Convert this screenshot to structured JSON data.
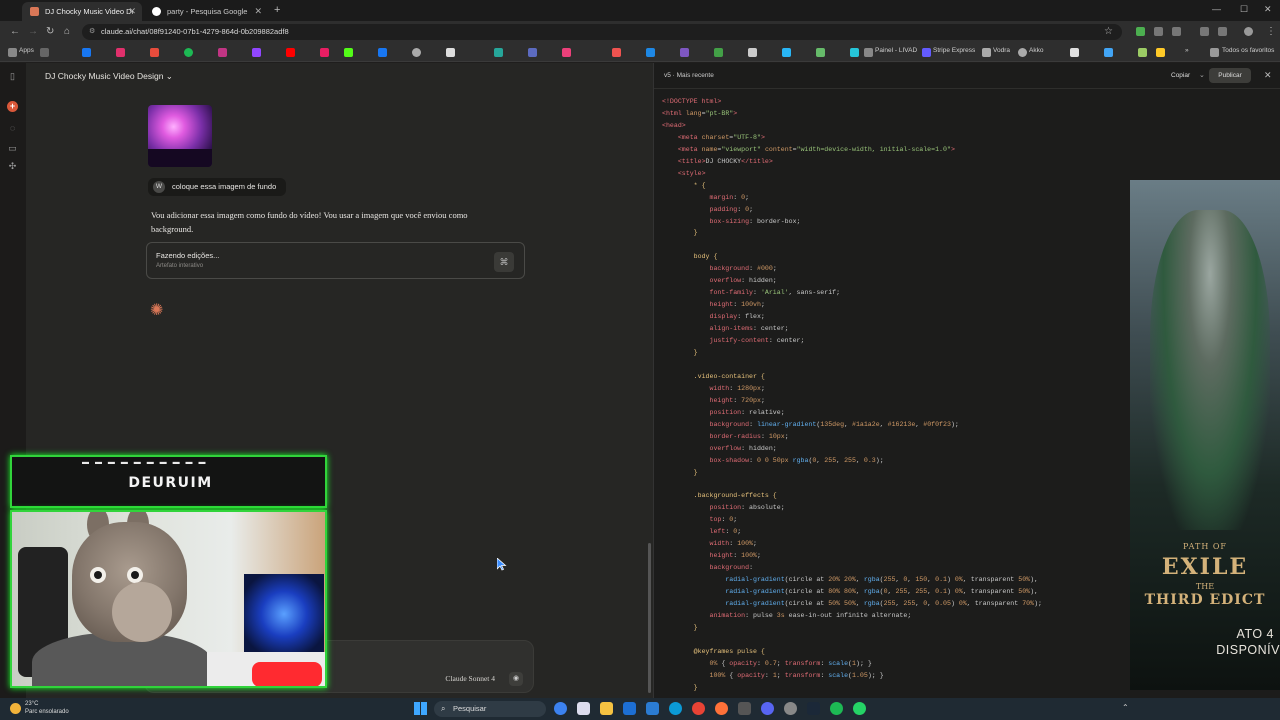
{
  "browser": {
    "tabs": [
      {
        "title": "DJ Chocky Music Video Design"
      },
      {
        "title": "party - Pesquisa Google"
      }
    ],
    "url": "claude.ai/chat/08f91240-07b1-4279-864d-0b209882adf8",
    "bookmarks": {
      "apps_label": "Apps",
      "items": [
        "Painel - LIVAD",
        "Stripe Express",
        "Vodra",
        "Akko"
      ],
      "all_favorites": "Todos os favoritos"
    }
  },
  "chat": {
    "title": "DJ Chocky Music Video Design",
    "user_avatar": "W",
    "user_message": "coloque essa imagem de fundo",
    "assistant_reply": "Vou adicionar essa imagem como fundo do vídeo! Vou usar a imagem que você enviou como background.",
    "artifact": {
      "title": "Fazendo edições...",
      "subtitle": "Artefato interativo"
    },
    "model_label": "Claude Sonnet 4"
  },
  "code_panel": {
    "version": "v5 · Mais recente",
    "copy_label": "Copiar",
    "publish_label": "Publicar"
  },
  "ad": {
    "line1": "PATH OF",
    "line2": "EXILE",
    "line3": "THE",
    "line4": "THIRD EDICT",
    "ato": "ATO 4",
    "disp": "DISPONÍV"
  },
  "webcam": {
    "title": "DEURUIM",
    "accent": "#31d43b"
  },
  "taskbar": {
    "temperature": "23°C",
    "weather": "Parc ensolarado",
    "search": "Pesquisar"
  }
}
